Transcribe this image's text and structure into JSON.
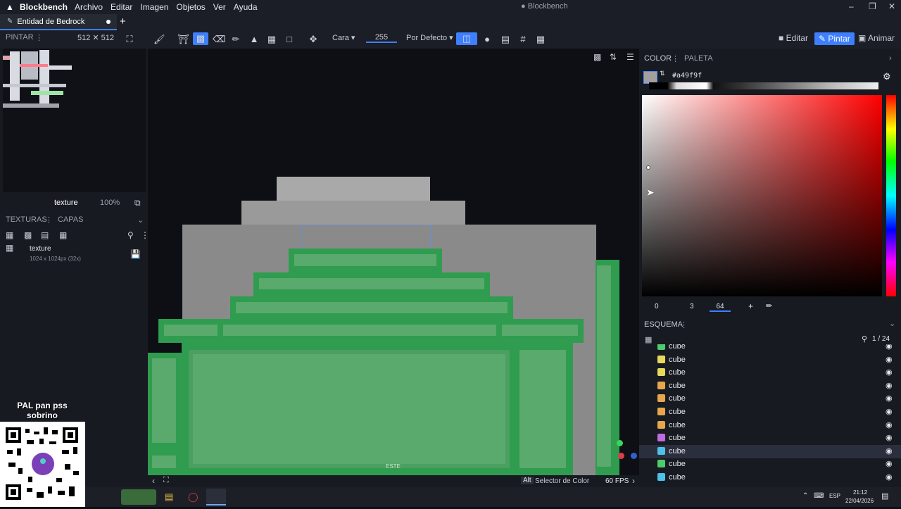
{
  "app": {
    "name": "Blockbench",
    "window_title": "● Blockbench"
  },
  "menu": [
    "Archivo",
    "Editar",
    "Imagen",
    "Objetos",
    "Ver",
    "Ayuda"
  ],
  "tab": {
    "label": "Entidad de Bedrock"
  },
  "toolbar": {
    "panel_label": "PINTAR",
    "size": "512 ✕ 512",
    "mode": "Cara",
    "opacity": "255",
    "blend": "Por Defecto",
    "modes": [
      "Editar",
      "Pintar",
      "Animar"
    ]
  },
  "left": {
    "texture_label": "texture",
    "zoom": "100%",
    "tabs": [
      "TEXTURAS",
      "CAPAS"
    ],
    "texture_name": "texture",
    "texture_info": "1024 x 1024px (32x)"
  },
  "right": {
    "tabs": [
      "COLOR",
      "PALETA"
    ],
    "hex": "#a49f9f",
    "sliders": [
      "0",
      "3",
      "64"
    ],
    "outliner_title": "ESQUEMA",
    "count": "1 / 24",
    "items": [
      {
        "label": "cube",
        "color": "#4ecb6a"
      },
      {
        "label": "cube",
        "color": "#e6d95c"
      },
      {
        "label": "cube",
        "color": "#e6d95c"
      },
      {
        "label": "cube",
        "color": "#e8a54b"
      },
      {
        "label": "cube",
        "color": "#e8a54b"
      },
      {
        "label": "cube",
        "color": "#e8a54b"
      },
      {
        "label": "cube",
        "color": "#e8a54b"
      },
      {
        "label": "cube",
        "color": "#c06be0"
      },
      {
        "label": "cube",
        "color": "#4fc1e9",
        "selected": true
      },
      {
        "label": "cube",
        "color": "#4ecb6a"
      },
      {
        "label": "cube",
        "color": "#4fc1e9"
      }
    ]
  },
  "viewport": {
    "direction_label": "ESTE"
  },
  "status": {
    "key": "Alt",
    "hint": "Selector de Color",
    "fps": "60 FPS"
  },
  "overlay": {
    "line1": "PAL pan pss",
    "line2": "sobrino"
  },
  "taskbar": {
    "lang": "ESP",
    "time": "21:12",
    "date": "22/04/2026"
  }
}
